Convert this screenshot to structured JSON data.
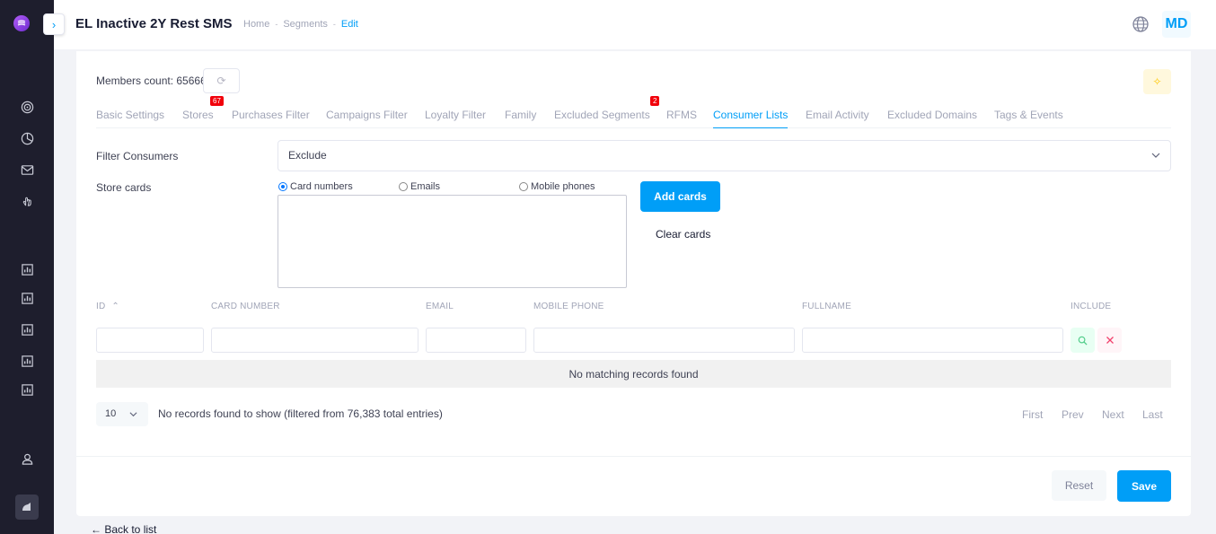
{
  "header": {
    "title": "EL Inactive 2Y Rest SMS",
    "breadcrumbs": [
      "Home",
      "Segments",
      "Edit"
    ],
    "avatar_initials": "MD",
    "accent_color": "#009ef7"
  },
  "sidebar": {
    "icons": [
      "logo-icon",
      "target-icon",
      "pie-chart-icon",
      "mail-icon",
      "hand-pointer-icon",
      "report-icon",
      "report-icon",
      "report-icon",
      "report-icon",
      "report-icon",
      "user-icon",
      "theme-icon"
    ]
  },
  "members": {
    "label": "Members count: 65666"
  },
  "tabs": [
    {
      "label": "Basic Settings"
    },
    {
      "label": "Stores",
      "badge": "67"
    },
    {
      "label": "Purchases Filter"
    },
    {
      "label": "Campaigns Filter"
    },
    {
      "label": "Loyalty Filter"
    },
    {
      "label": "Family"
    },
    {
      "label": "Excluded Segments",
      "badge": "2"
    },
    {
      "label": "RFMS"
    },
    {
      "label": "Consumer Lists",
      "active": true
    },
    {
      "label": "Email Activity"
    },
    {
      "label": "Excluded Domains"
    },
    {
      "label": "Tags & Events"
    }
  ],
  "form": {
    "filter_label": "Filter Consumers",
    "filter_value": "Exclude",
    "store_cards_label": "Store cards",
    "radios": [
      {
        "label": "Card numbers",
        "checked": true
      },
      {
        "label": "Emails",
        "checked": false
      },
      {
        "label": "Mobile phones",
        "checked": false
      }
    ],
    "add_button": "Add cards",
    "clear_button": "Clear cards"
  },
  "table": {
    "columns": [
      "ID",
      "CARD NUMBER",
      "EMAIL",
      "MOBILE PHONE",
      "FULLNAME",
      "INCLUDE"
    ],
    "empty_message": "No matching records found",
    "page_size": "10",
    "info": "No records found to show (filtered from 76,383 total entries)",
    "pagination": [
      "First",
      "Prev",
      "Next",
      "Last"
    ]
  },
  "footer": {
    "reset": "Reset",
    "save": "Save",
    "back": "← Back to list"
  }
}
